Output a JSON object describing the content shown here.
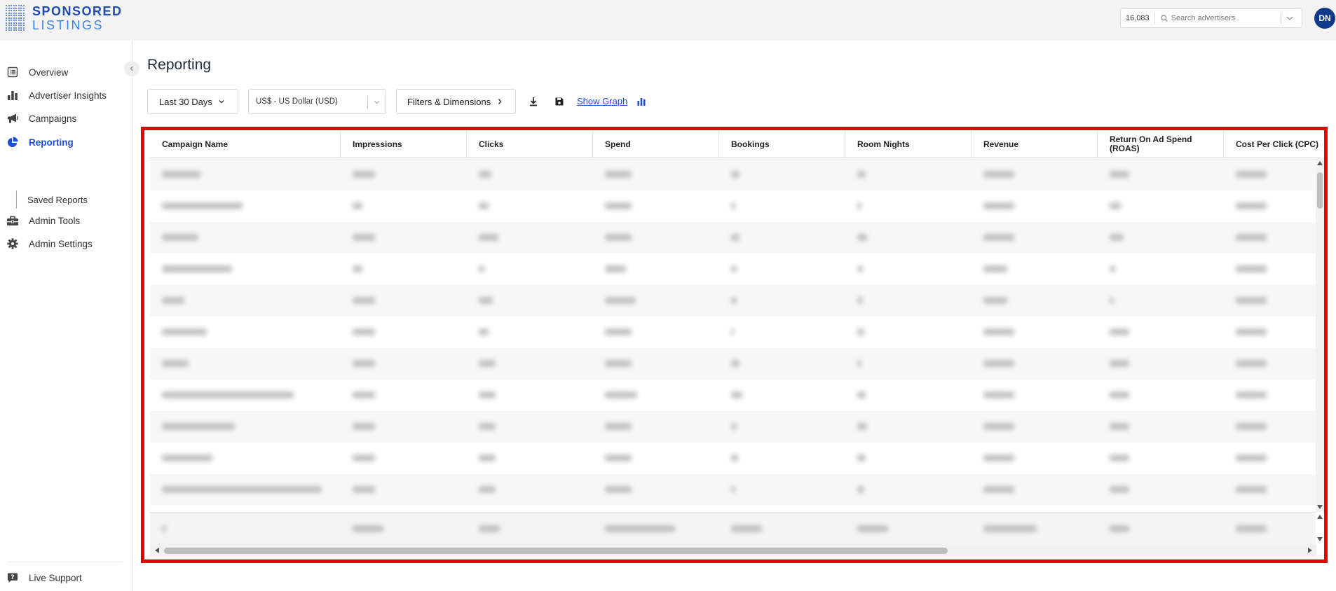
{
  "header": {
    "logo_line1": "SPONSORED",
    "logo_line2": "LISTINGS",
    "advertiser_count": "16,083",
    "search_placeholder": "Search advertisers",
    "avatar_initials": "DN"
  },
  "sidebar": {
    "items": [
      {
        "label": "Overview",
        "icon": "list-icon"
      },
      {
        "label": "Advertiser Insights",
        "icon": "bar-chart-icon"
      },
      {
        "label": "Campaigns",
        "icon": "megaphone-icon"
      },
      {
        "label": "Reporting",
        "icon": "pie-chart-icon",
        "active": true
      },
      {
        "label": "Admin Tools",
        "icon": "toolbox-icon"
      },
      {
        "label": "Admin Settings",
        "icon": "gear-icon"
      }
    ],
    "sub_items": [
      {
        "label": "Saved Reports"
      }
    ],
    "live_support": "Live Support"
  },
  "page": {
    "title": "Reporting"
  },
  "toolbar": {
    "date_range": "Last 30 Days",
    "currency": "US$ - US Dollar (USD)",
    "filters": "Filters & Dimensions",
    "show_graph": "Show Graph"
  },
  "table": {
    "columns": [
      "Campaign Name",
      "Impressions",
      "Clicks",
      "Spend",
      "Bookings",
      "Room Nights",
      "Revenue",
      "Return On Ad Spend (ROAS)",
      "Cost Per Click (CPC)"
    ],
    "blurred_rows": 11,
    "has_total_row": true
  },
  "colors": {
    "accent": "#1d4ed8",
    "highlight_border": "#e60000",
    "avatar_bg": "#0f3a8c"
  }
}
